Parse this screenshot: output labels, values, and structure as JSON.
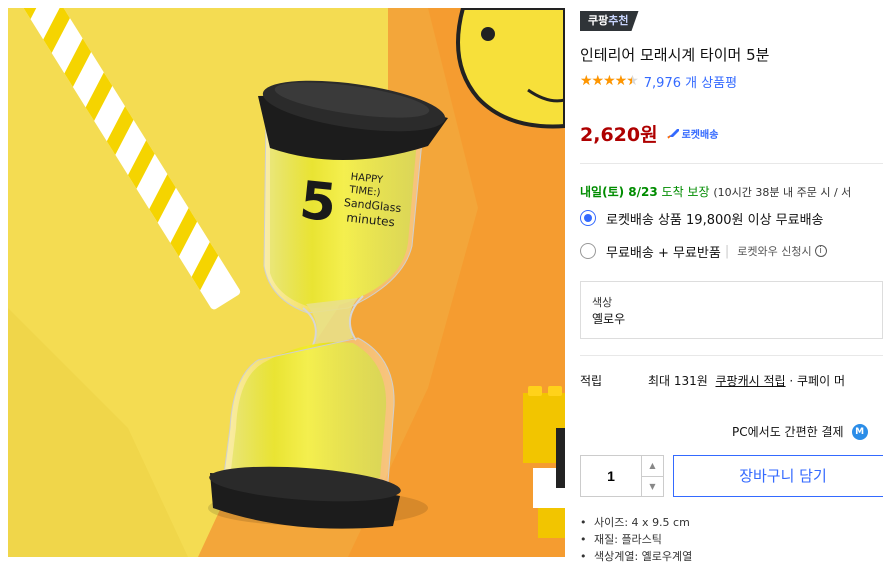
{
  "product": {
    "badge_text": "쿠팡",
    "badge_accent": "추천",
    "title": "인테리어 모래시계 타이머 5분",
    "rating": 4.5,
    "rating_stars": "★★★★★",
    "review_count_text": "7,976 개 상품평",
    "price": "2,620원",
    "rocket_label": "로켓배송"
  },
  "hourglass_print": {
    "number": "5",
    "line1": "HAPPY",
    "line2": "TIME:)",
    "line3": "SandGlass",
    "line4": "minutes"
  },
  "delivery": {
    "date": "내일(토) 8/23",
    "guarantee": "도착 보장",
    "note": "(10시간 38분 내 주문 시 / 서"
  },
  "shipping_options": [
    {
      "label": "로켓배송 상품 19,800원 이상 무료배송",
      "selected": true
    },
    {
      "label": "무료배송 + 무료반품",
      "sub": "로켓와우 신청시",
      "selected": false
    }
  ],
  "option": {
    "label": "색상",
    "value": "옐로우"
  },
  "points": {
    "key": "적립",
    "text_before": "최대 131원",
    "link": "쿠팡캐시 적립",
    "text_after": "· 쿠페이 머"
  },
  "pc_payment": {
    "text": "PC에서도 간편한 결제",
    "icon_letter": "M"
  },
  "purchase": {
    "quantity": "1",
    "cart_button": "장바구니 담기"
  },
  "specs": [
    "사이즈: 4 x 9.5 cm",
    "재질: 플라스틱",
    "색상계열: 옐로우계열"
  ],
  "colors": {
    "accent_blue": "#346aff",
    "price_red": "#ae0000",
    "delivery_green": "#008c00",
    "star_orange": "#ff9600"
  }
}
